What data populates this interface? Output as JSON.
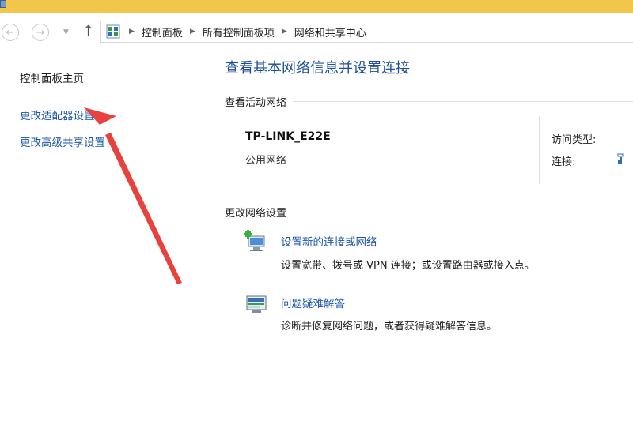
{
  "breadcrumb": [
    "控制面板",
    "所有控制面板项",
    "网络和共享中心"
  ],
  "sidebar": {
    "home": "控制面板主页",
    "links": [
      "更改适配器设置",
      "更改高级共享设置"
    ]
  },
  "main": {
    "title": "查看基本网络信息并设置连接",
    "active_section": "查看活动网络",
    "network": {
      "name": "TP-LINK_E22E",
      "type": "公用网络",
      "access_label": "访问类型:",
      "connection_label": "连接:"
    },
    "change_section": "更改网络设置",
    "tasks": [
      {
        "link": "设置新的连接或网络",
        "desc": "设置宽带、拨号或 VPN 连接；或设置路由器或接入点。"
      },
      {
        "link": "问题疑难解答",
        "desc": "诊断并修复网络问题，或者获得疑难解答信息。"
      }
    ]
  },
  "icons": {
    "back": "back-arrow-icon",
    "forward": "forward-arrow-icon",
    "up": "up-arrow-icon",
    "control_panel": "control-panel-icon",
    "new_connection": "new-connection-icon",
    "troubleshoot": "troubleshoot-icon",
    "signal": "wifi-signal-icon"
  },
  "colors": {
    "link": "#1a54a6",
    "title": "#1f4f95",
    "titlebar": "#f2c64b",
    "annotation_arrow": "#e8423f"
  }
}
